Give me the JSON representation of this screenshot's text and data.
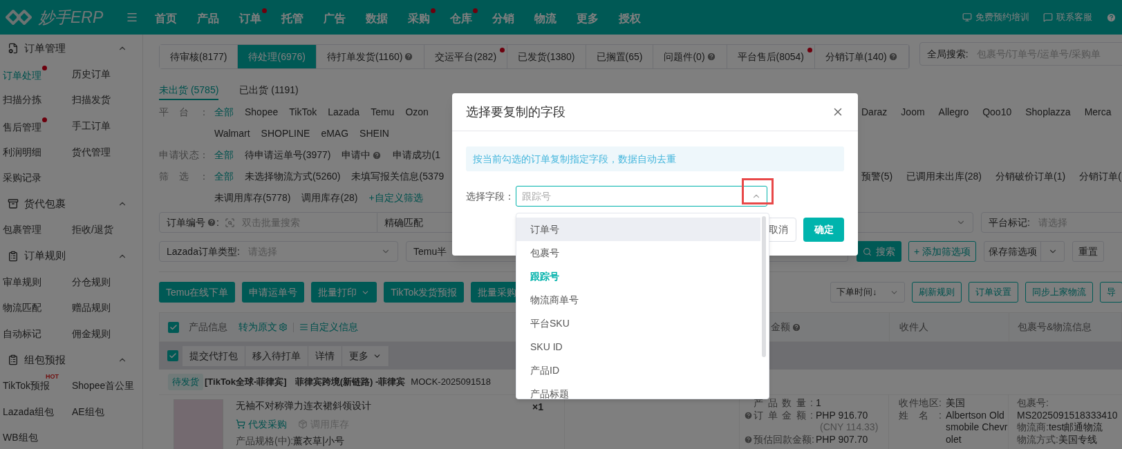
{
  "header": {
    "logo": "妙手ERP",
    "nav": [
      {
        "label": "首页",
        "dot": false
      },
      {
        "label": "产品",
        "dot": false
      },
      {
        "label": "订单",
        "dot": true
      },
      {
        "label": "托管",
        "dot": false
      },
      {
        "label": "广告",
        "dot": false
      },
      {
        "label": "数据",
        "dot": false
      },
      {
        "label": "采购",
        "dot": true
      },
      {
        "label": "仓库",
        "dot": true
      },
      {
        "label": "分销",
        "dot": false
      },
      {
        "label": "物流",
        "dot": false
      },
      {
        "label": "更多",
        "dot": false
      },
      {
        "label": "授权",
        "dot": false
      }
    ],
    "links": [
      "免费预约培训",
      "联系客服"
    ]
  },
  "sidebar": {
    "sections": [
      {
        "title": "订单管理",
        "expanded": true,
        "items": [
          {
            "label": "订单处理",
            "selected": true,
            "dot": true
          },
          {
            "label": "历史订单",
            "selected": false,
            "dot": false
          },
          {
            "label": "扫描分拣",
            "selected": false,
            "dot": false
          },
          {
            "label": "扫描发货",
            "selected": false,
            "dot": false
          },
          {
            "label": "售后管理",
            "selected": false,
            "dot": true
          },
          {
            "label": "手工订单",
            "selected": false,
            "dot": false
          },
          {
            "label": "利润明细",
            "selected": false,
            "dot": false
          },
          {
            "label": "货代管理",
            "selected": false,
            "dot": false
          },
          {
            "label": "采购记录",
            "selected": false,
            "dot": false
          }
        ]
      },
      {
        "title": "货代包裹",
        "expanded": true,
        "items": [
          {
            "label": "包裹管理",
            "selected": false,
            "dot": false
          },
          {
            "label": "拒收/退货",
            "selected": false,
            "dot": false
          }
        ]
      },
      {
        "title": "订单规则",
        "expanded": true,
        "items": [
          {
            "label": "审单规则",
            "selected": false,
            "dot": false
          },
          {
            "label": "分仓规则",
            "selected": false,
            "dot": false
          },
          {
            "label": "物流匹配",
            "selected": false,
            "dot": false
          },
          {
            "label": "赠品规则",
            "selected": false,
            "dot": false
          },
          {
            "label": "自动标记",
            "selected": false,
            "dot": false
          },
          {
            "label": "佣金规则",
            "selected": false,
            "dot": false
          }
        ]
      },
      {
        "title": "组包预报",
        "expanded": true,
        "items": [
          {
            "label": "TikTok预报",
            "selected": false,
            "dot": false,
            "badge": "HOT"
          },
          {
            "label": "Shopee首公里",
            "selected": false,
            "dot": false
          },
          {
            "label": "Lazada组包",
            "selected": false,
            "dot": false
          },
          {
            "label": "AE组包",
            "selected": false,
            "dot": false
          },
          {
            "label": "WB组包",
            "selected": false,
            "dot": false
          }
        ]
      }
    ]
  },
  "status_tabs": [
    {
      "label": "待审核(8177)",
      "selected": false,
      "help": false,
      "dot": false
    },
    {
      "label": "待处理(6976)",
      "selected": true,
      "help": false,
      "dot": false
    },
    {
      "label": "待打单发货(1160)",
      "selected": false,
      "help": true,
      "dot": false
    },
    {
      "label": "交运平台(282)",
      "selected": false,
      "help": false,
      "dot": true
    },
    {
      "label": "已发货(1380)",
      "selected": false,
      "help": false,
      "dot": false
    },
    {
      "label": "已搁置(65)",
      "selected": false,
      "help": false,
      "dot": false
    },
    {
      "label": "问题件(0)",
      "selected": false,
      "help": true,
      "dot": false
    },
    {
      "label": "平台售后(8054)",
      "selected": false,
      "help": false,
      "dot": true
    },
    {
      "label": "分销订单(140)",
      "selected": false,
      "help": true,
      "dot": false
    }
  ],
  "global_search": {
    "label": "全局搜索:",
    "placeholder": "包裹号/订单号/运单号/采购单"
  },
  "ship_tabs": [
    {
      "label": "未出货 (5785)",
      "selected": true
    },
    {
      "label": "已出货 (1191)",
      "selected": false
    }
  ],
  "filter_rows": [
    {
      "label": "平台：",
      "options": [
        {
          "label": "全部",
          "selected": true,
          "help": false
        },
        {
          "label": "Shopee",
          "selected": false,
          "help": false
        },
        {
          "label": "TikTok",
          "selected": false,
          "help": false
        },
        {
          "label": "Lazada",
          "selected": false,
          "help": false
        },
        {
          "label": "Temu",
          "selected": false,
          "help": false
        },
        {
          "label": "Ozon",
          "selected": false,
          "help": false
        }
      ],
      "options_right": [
        {
          "label": "Daraz",
          "selected": false
        },
        {
          "label": "Joom",
          "selected": false
        },
        {
          "label": "Allegro",
          "selected": false
        },
        {
          "label": "Qoo10",
          "selected": false
        },
        {
          "label": "Shoplazza",
          "selected": false
        },
        {
          "label": "Merca",
          "selected": false
        }
      ]
    },
    {
      "options": [
        {
          "label": "Walmart",
          "selected": false,
          "help": false
        },
        {
          "label": "SHOPLINE",
          "selected": false,
          "help": false
        },
        {
          "label": "eMAG",
          "selected": false,
          "help": false
        },
        {
          "label": "SHEIN",
          "selected": false,
          "help": false
        }
      ]
    },
    {
      "label": "申请状态：",
      "options": [
        {
          "label": "全部",
          "selected": true,
          "help": false
        },
        {
          "label": "待申请运单号(3977)",
          "selected": false,
          "help": false
        },
        {
          "label": "申请中",
          "selected": false,
          "help": true
        },
        {
          "label": "申请成功(1",
          "selected": false,
          "help": false
        }
      ]
    },
    {
      "label": "筛选：",
      "options": [
        {
          "label": "全部",
          "selected": true,
          "help": false
        },
        {
          "label": "未选择物流方式(5260)",
          "selected": false,
          "help": false
        },
        {
          "label": "未填写报关信息(5379",
          "selected": false,
          "help": false
        }
      ],
      "options_right": [
        {
          "label": "预警(5)",
          "selected": false
        },
        {
          "label": "已调用未出库(28)",
          "selected": false
        },
        {
          "label": "分销破价订单(1)",
          "selected": false
        },
        {
          "label": "分销订单(",
          "selected": false
        }
      ]
    },
    {
      "options": [
        {
          "label": "未调用库存(5778)",
          "selected": false,
          "help": false
        },
        {
          "label": "调用库存(28)",
          "selected": false,
          "help": false
        }
      ],
      "link": "+自定义筛选"
    }
  ],
  "search": {
    "order_no": {
      "label": "订单编号",
      "help": true,
      "colon": ":",
      "placeholder": "双击批量搜索",
      "match": "精确匹配"
    },
    "platform_mark": {
      "label": "平台标记:",
      "placeholder": "请选择"
    },
    "lazada_type": {
      "label": "Lazada订单类型:",
      "placeholder": "请选择"
    },
    "temu_select": "Temu半",
    "search_button": "搜索",
    "add_filter": "+ 添加筛选项",
    "save_filter": "保存筛选项",
    "reset": "重置"
  },
  "actions": {
    "left": [
      {
        "label": "Temu在线下单",
        "caret": false
      },
      {
        "label": "申请运单号",
        "caret": false
      },
      {
        "label": "批量打印",
        "caret": true
      },
      {
        "label": "TikTok发货预报",
        "caret": false
      },
      {
        "label": "批量采购",
        "caret": false
      }
    ],
    "sort": "下单时间↓",
    "right": [
      "刷新规则",
      "订单设置",
      "同步上家物流",
      "导"
    ]
  },
  "table": {
    "checked": true,
    "product_info": "产品信息",
    "translate": "转为原文",
    "custom_info": "自定义信息",
    "amount": "金额",
    "amount_help": true,
    "receiver": "收件人",
    "package": "包裹号&物流信息"
  },
  "bulk": {
    "checked": true,
    "buttons": [
      {
        "label": "提交代打包",
        "caret": false
      },
      {
        "label": "移入待打单",
        "caret": false
      },
      {
        "label": "详情",
        "caret": false
      },
      {
        "label": "更多",
        "caret": true
      }
    ]
  },
  "order": {
    "status": "待发货",
    "store": "[TikTok全球-菲律宾]",
    "site": "菲律宾跨境(新链路) -菲律宾",
    "order_no": "MOCK-2025091518",
    "product": {
      "title": "无袖不对称弹力连衣裙斜领设计",
      "purchase": "代发采购",
      "stock": "调用库存",
      "stock_disabled": true,
      "spec_label": "产品规格(中):",
      "spec": "薰衣草|小号",
      "quantity": "×1"
    },
    "amounts": [
      {
        "label": "产品数量:",
        "value": "1",
        "help": false
      },
      {
        "label": "订单金额:",
        "value": "PHP 916.70",
        "help": true,
        "note": "(CNY 114.33)"
      },
      {
        "label": "预估回款金额:",
        "value": "PHP 907.70",
        "help": true
      }
    ],
    "receiver": [
      {
        "label": "收件地区:",
        "value": "美国"
      },
      {
        "label": "姓名:",
        "value": "Albertson Oldsmobile Chevrolet"
      }
    ],
    "package": [
      {
        "label": "包裹号:",
        "value": "MS2025091518333410",
        "kind": "stacked"
      },
      {
        "label": "物流商:",
        "value": "test邮通物流",
        "kind": "inline"
      },
      {
        "label": "物流方式:",
        "value": "美国专线",
        "kind": "inline"
      }
    ]
  },
  "modal": {
    "title": "选择要复制的字段",
    "notice": "按当前勾选的订单复制指定字段，数据自动去重",
    "field_label": "选择字段：",
    "field_value": "跟踪号",
    "open": true,
    "toggle_highlighted": true,
    "cancel": "取消",
    "confirm": "确定",
    "options": [
      {
        "label": "订单号",
        "selected": false,
        "highlighted": true
      },
      {
        "label": "包裹号",
        "selected": false,
        "highlighted": false
      },
      {
        "label": "跟踪号",
        "selected": true,
        "highlighted": false
      },
      {
        "label": "物流商单号",
        "selected": false,
        "highlighted": false
      },
      {
        "label": "平台SKU",
        "selected": false,
        "highlighted": false
      },
      {
        "label": "SKU ID",
        "selected": false,
        "highlighted": false
      },
      {
        "label": "产品ID",
        "selected": false,
        "highlighted": false
      },
      {
        "label": "产品标题",
        "selected": false,
        "highlighted": false
      }
    ]
  }
}
